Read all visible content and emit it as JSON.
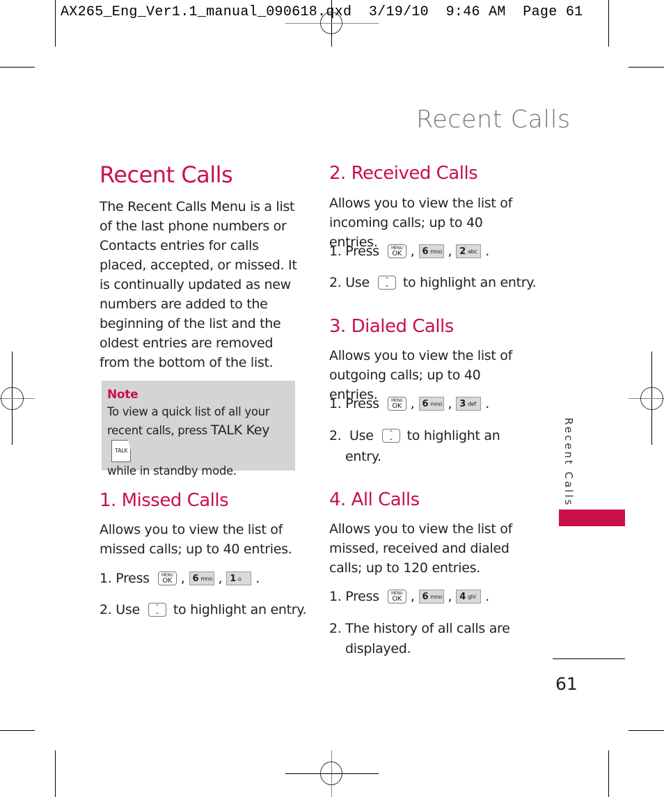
{
  "slug": "AX265_Eng_Ver1.1_manual_090618.qxd  3/19/10  9:46 AM  Page 61",
  "running_head": "Recent Calls",
  "main": {
    "title": "Recent Calls",
    "intro": "The Recent Calls Menu is a list of the last phone numbers or Contacts entries for calls placed, accepted, or missed. It is continually updated as new numbers are added to the beginning of the list and the oldest entries are removed from the bottom of the list."
  },
  "note": {
    "title": "Note",
    "line1": "To view a quick list of all your recent calls, press",
    "key_label": "TALK Key",
    "talk_icon": "TALK",
    "line2": "while in standby mode."
  },
  "keys": {
    "menu_top": "MENU",
    "menu_bottom": "OK",
    "nav_up": "⌃",
    "nav_down": "⌄",
    "comma": ",",
    "period": "."
  },
  "sections": [
    {
      "heading": "1. Missed Calls",
      "desc": "Allows you to view the list of missed calls; up to 40 entries.",
      "step1": "1. Press",
      "key_digit": "6",
      "key_letters": "mno",
      "key2_digit": "1",
      "key2_letters": "⌂",
      "step2_pre": "2. Use",
      "step2_post": "to highlight an entry."
    },
    {
      "heading": "2. Received Calls",
      "desc": "Allows you to view the list of incoming calls; up to 40 entries.",
      "step1": "1. Press",
      "key_digit": "6",
      "key_letters": "mno",
      "key2_digit": "2",
      "key2_letters": "abc",
      "step2_pre": "2. Use",
      "step2_post": "to highlight an entry."
    },
    {
      "heading": "3. Dialed Calls",
      "desc": "Allows you to view the list of outgoing calls; up to 40 entries.",
      "step1": "1. Press",
      "key_digit": "6",
      "key_letters": "mno",
      "key2_digit": "3",
      "key2_letters": "def",
      "step2_pre": "2.  Use",
      "step2_post": "to highlight an",
      "step2_cont": "entry."
    },
    {
      "heading": "4. All Calls",
      "desc": "Allows you to view the list of missed, received and dialed calls; up to 120 entries.",
      "step1": "1. Press",
      "key_digit": "6",
      "key_letters": "mno",
      "key2_digit": "4",
      "key2_letters": "ghi",
      "step2_pre": "2. The history of all calls are",
      "step2_cont": "displayed."
    }
  ],
  "side_tab": "Recent Calls",
  "page_number": "61",
  "colors": {
    "accent": "#c8104a",
    "note_bg": "#d4d4d4",
    "running_head": "#777777"
  }
}
